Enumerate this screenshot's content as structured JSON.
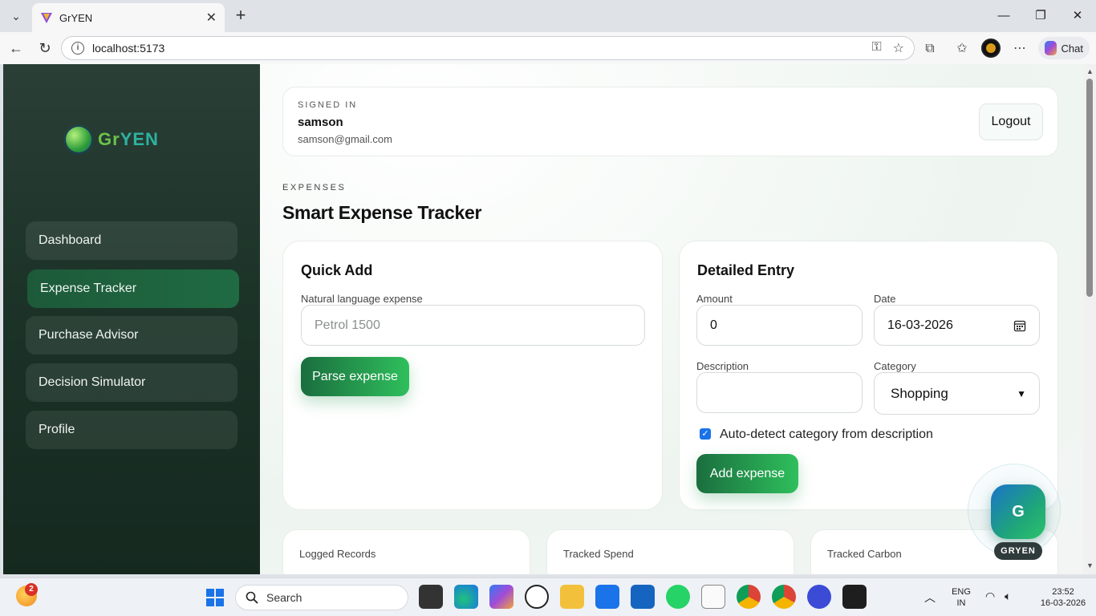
{
  "browser": {
    "tab_title": "GrYEN",
    "tab_close": "✕",
    "new_tab": "+",
    "url": "localhost:5173",
    "chat_label": "Chat"
  },
  "sidebar": {
    "logo_prefix": "Gr",
    "logo_suffix": "YEN",
    "items": [
      {
        "label": "Dashboard",
        "active": false
      },
      {
        "label": "Expense Tracker",
        "active": true
      },
      {
        "label": "Purchase Advisor",
        "active": false
      },
      {
        "label": "Decision Simulator",
        "active": false
      },
      {
        "label": "Profile",
        "active": false
      }
    ]
  },
  "user": {
    "label": "SIGNED IN",
    "name": "samson",
    "email": "samson@gmail.com",
    "logout": "Logout"
  },
  "page": {
    "section": "EXPENSES",
    "title": "Smart Expense Tracker"
  },
  "quick_add": {
    "title": "Quick Add",
    "field_label": "Natural language expense",
    "placeholder": "Petrol 1500",
    "button": "Parse expense"
  },
  "detailed": {
    "title": "Detailed Entry",
    "amount_label": "Amount",
    "amount_value": "0",
    "date_label": "Date",
    "date_value": "16-03-2026",
    "description_label": "Description",
    "description_value": "",
    "category_label": "Category",
    "category_value": "Shopping",
    "auto_detect_label": "Auto-detect category from description",
    "auto_detect_checked": true,
    "button": "Add expense"
  },
  "stats": [
    {
      "label": "Logged Records"
    },
    {
      "label": "Tracked Spend"
    },
    {
      "label": "Tracked Carbon"
    }
  ],
  "assistant": {
    "initial": "G",
    "label": "GRYEN"
  },
  "taskbar": {
    "search": "Search",
    "notification_count": "2",
    "lang_top": "ENG",
    "lang_bottom": "IN",
    "time": "23:52",
    "date": "16-03-2026"
  },
  "colors": {
    "accent": "#1f6b42",
    "sidebar_bg": "#1c3328",
    "button_gradient_start": "#1a6e3e",
    "button_gradient_end": "#2fbf5c"
  }
}
